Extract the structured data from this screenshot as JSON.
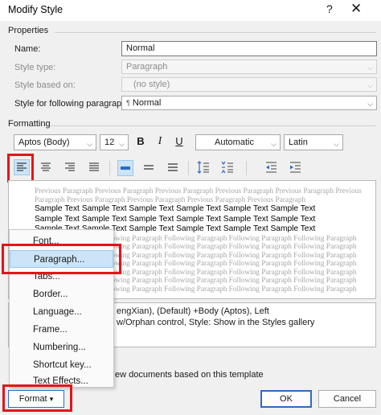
{
  "dialog": {
    "title": "Modify Style",
    "help": "?",
    "close": "✕"
  },
  "properties": {
    "section": "Properties",
    "name_label": "Name:",
    "name_value": "Normal",
    "style_type_label": "Style type:",
    "style_type_value": "Paragraph",
    "based_on_label": "Style based on:",
    "based_on_value": "(no style)",
    "following_label": "Style for following paragraph:",
    "following_value": "Normal",
    "following_mark": "¶"
  },
  "formatting": {
    "section": "Formatting",
    "font": "Aptos (Body)",
    "size": "12",
    "bold": "B",
    "italic": "I",
    "underline": "U",
    "color": "Automatic",
    "script": "Latin"
  },
  "preview": {
    "previous_lines": [
      "Previous Paragraph Previous Paragraph Previous Paragraph Previous Paragraph Previous Paragraph Previous",
      "Paragraph Previous Paragraph Previous Paragraph Previous Paragraph Previous Paragraph"
    ],
    "sample_lines": [
      "Sample Text Sample Text Sample Text Sample Text Sample Text Sample Text",
      "Sample Text Sample Text Sample Text Sample Text Sample Text Sample Text",
      "Sample Text Sample Text Sample Text Sample Text Sample Text Sample Text"
    ],
    "following_lines": [
      "Following Paragraph Following Paragraph Following Paragraph Following Paragraph Following Paragraph",
      "Following Paragraph Following Paragraph Following Paragraph Following Paragraph Following Paragraph",
      "Following Paragraph Following Paragraph Following Paragraph Following Paragraph Following Paragraph",
      "Following Paragraph Following Paragraph Following Paragraph Following Paragraph Following Paragraph",
      "Following Paragraph Following Paragraph Following Paragraph Following Paragraph Following Paragraph",
      "Following Paragraph Following Paragraph Following Paragraph Following Paragraph Following Paragraph",
      "Following Paragraph Following Paragraph Following Paragraph Following Paragraph Following Paragraph"
    ]
  },
  "description": {
    "line1": "engXian), (Default) +Body (Aptos), Left",
    "line2": "w/Orphan control, Style: Show in the Styles gallery"
  },
  "template_option": "ew documents based on this template",
  "menu": {
    "items": [
      "Font...",
      "Paragraph...",
      "Tabs...",
      "Border...",
      "Language...",
      "Frame...",
      "Numbering...",
      "Shortcut key...",
      "Text Effects..."
    ]
  },
  "buttons": {
    "format": "Format",
    "format_arrow": "▾",
    "ok": "OK",
    "cancel": "Cancel"
  },
  "colors": {
    "highlight": "#cce4f7",
    "annotation_red": "#e3141c",
    "accent": "#2b6cc4"
  }
}
